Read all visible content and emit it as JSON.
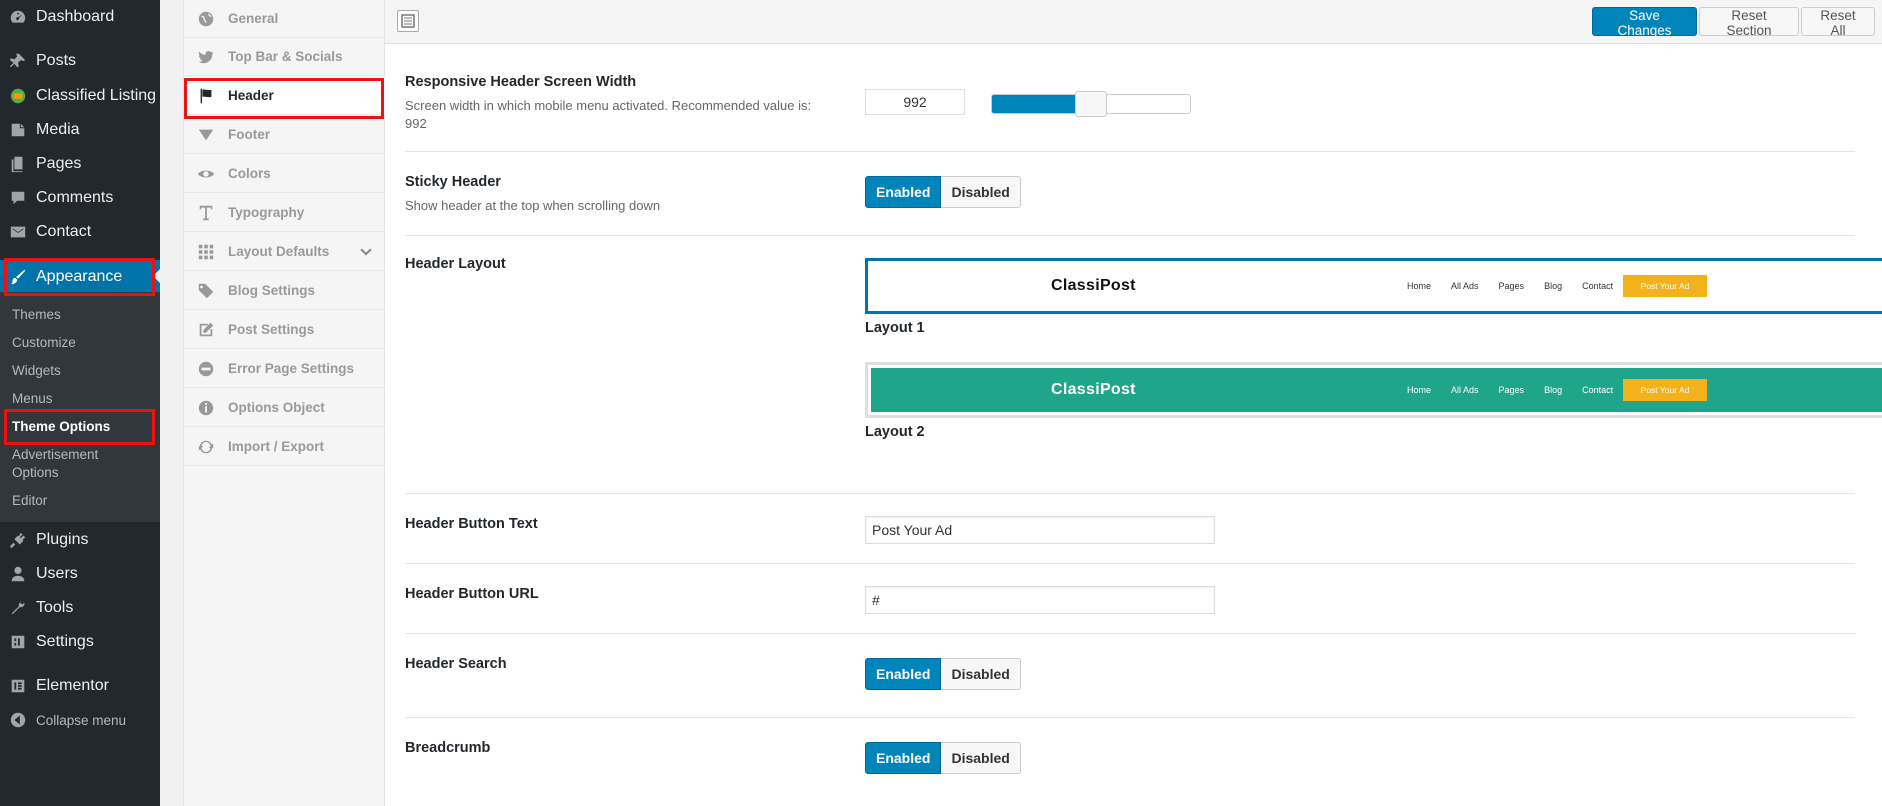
{
  "admin_menu": {
    "items": [
      {
        "label": "Dashboard",
        "icon": "dashboard-icon"
      },
      {
        "label": "Posts",
        "icon": "pin-icon"
      },
      {
        "label": "Classified Listing",
        "icon": "classified-listing-icon"
      },
      {
        "label": "Media",
        "icon": "media-icon"
      },
      {
        "label": "Pages",
        "icon": "pages-icon"
      },
      {
        "label": "Comments",
        "icon": "comment-icon"
      },
      {
        "label": "Contact",
        "icon": "mail-icon"
      },
      {
        "label": "Appearance",
        "icon": "paintbrush-icon"
      },
      {
        "label": "Plugins",
        "icon": "plugin-icon"
      },
      {
        "label": "Users",
        "icon": "user-icon"
      },
      {
        "label": "Tools",
        "icon": "wrench-icon"
      },
      {
        "label": "Settings",
        "icon": "settings-icon"
      },
      {
        "label": "Elementor",
        "icon": "elementor-icon"
      },
      {
        "label": "Collapse menu",
        "icon": "collapse-icon"
      }
    ],
    "appearance_sub": [
      "Themes",
      "Customize",
      "Widgets",
      "Menus",
      "Theme Options",
      "Advertisement Options",
      "Editor"
    ]
  },
  "options_nav": [
    {
      "label": "General",
      "icon": "globe-icon"
    },
    {
      "label": "Top Bar & Socials",
      "icon": "twitter-icon"
    },
    {
      "label": "Header",
      "icon": "flag-icon"
    },
    {
      "label": "Footer",
      "icon": "triangle-down-icon"
    },
    {
      "label": "Colors",
      "icon": "eye-icon"
    },
    {
      "label": "Typography",
      "icon": "text-icon"
    },
    {
      "label": "Layout Defaults",
      "icon": "grid-icon"
    },
    {
      "label": "Blog Settings",
      "icon": "tags-icon"
    },
    {
      "label": "Post Settings",
      "icon": "edit-icon"
    },
    {
      "label": "Error Page Settings",
      "icon": "no-entry-icon"
    },
    {
      "label": "Options Object",
      "icon": "info-icon"
    },
    {
      "label": "Import / Export",
      "icon": "refresh-icon"
    }
  ],
  "toolbar": {
    "save_label": "Save Changes",
    "reset_section_label": "Reset Section",
    "reset_all_label": "Reset All"
  },
  "settings": {
    "responsive_width": {
      "title": "Responsive Header Screen Width",
      "desc": "Screen width in which mobile menu activated. Recommended value is: 992",
      "value": "992",
      "slider_fraction": 0.5
    },
    "sticky_header": {
      "title": "Sticky Header",
      "desc": "Show header at the top when scrolling down",
      "enabled": "Enabled",
      "disabled": "Disabled"
    },
    "header_layout": {
      "title": "Header Layout",
      "layouts": [
        {
          "caption": "Layout 1",
          "bg": "#ffffff",
          "logo_color": "#111111",
          "nav_color": "#333333"
        },
        {
          "caption": "Layout 2",
          "bg": "#1fa58a",
          "logo_color": "#ffffff",
          "nav_color": "#ffffff"
        }
      ],
      "preview": {
        "logo": "ClassiPost",
        "nav": [
          "Home",
          "All Ads",
          "Pages",
          "Blog",
          "Contact"
        ],
        "button": "Post Your Ad"
      }
    },
    "header_button_text": {
      "title": "Header Button Text",
      "value": "Post Your Ad"
    },
    "header_button_url": {
      "title": "Header Button URL",
      "value": "#"
    },
    "header_search": {
      "title": "Header Search",
      "enabled": "Enabled",
      "disabled": "Disabled"
    },
    "breadcrumb": {
      "title": "Breadcrumb",
      "enabled": "Enabled",
      "disabled": "Disabled"
    }
  },
  "colors": {
    "accent": "#0085ba",
    "highlight_box": "#e11111",
    "admin_bg": "#23282d"
  }
}
